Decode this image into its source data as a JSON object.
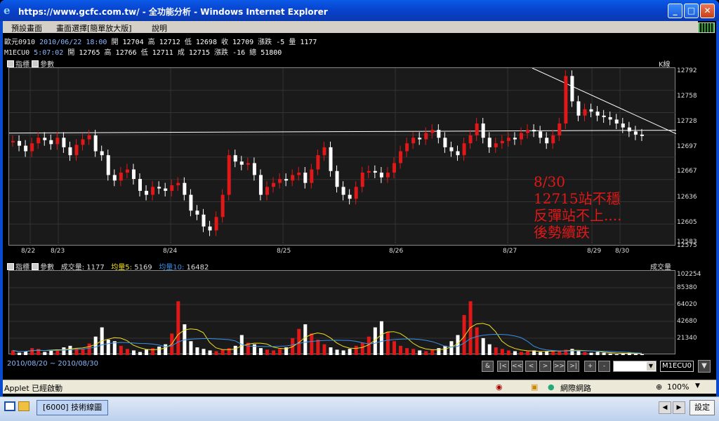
{
  "window": {
    "title": "https://www.gcfc.com.tw/ - 全功能分析 - Windows Internet Explorer"
  },
  "menu": {
    "items": [
      "預設畫面",
      "畫面選擇[簡單放大版]",
      "說明"
    ]
  },
  "quotes": [
    {
      "label": "歐元0910",
      "date": "2010/06/22 18:00",
      "open": "12704",
      "high": "12712",
      "low": "12698",
      "close_label": "收",
      "close": "12709",
      "chg": "-5",
      "vol_label": "量",
      "vol": "1177"
    },
    {
      "label": "M1ECU0",
      "date": "5:07:02",
      "open": "12765",
      "high": "12766",
      "low": "12711",
      "close_label": "成",
      "close": "12715",
      "chg": "-16",
      "vol_label": "總",
      "vol": "51800"
    }
  ],
  "quote_labels": {
    "open": "開",
    "high": "高",
    "low": "低",
    "chg": "漲跌"
  },
  "price_panel": {
    "header_indicator": "指標",
    "header_param": "參數",
    "kline_label": "K線",
    "y_ticks": [
      "12792",
      "12758",
      "12728",
      "12697",
      "12667",
      "12636",
      "12605",
      "12583",
      "12575"
    ],
    "x_ticks": [
      "8/22",
      "8/23",
      "8/24",
      "8/25",
      "8/26",
      "8/27",
      "8/29",
      "8/30"
    ]
  },
  "annotation": [
    "8/30",
    "12715站不穩",
    "反彈站不上....",
    "後勢續跌"
  ],
  "volume_panel": {
    "header_indicator": "指標",
    "header_param": "參數",
    "vol_label": "成交量:",
    "vol_value": "1177",
    "ma5_label": "均量5:",
    "ma5_value": "5169",
    "ma10_label": "均量10:",
    "ma10_value": "16482",
    "right_label": "成交量",
    "y_ticks": [
      "102254",
      "85380",
      "64020",
      "42680",
      "21340"
    ]
  },
  "range": "2010/08/20 ~ 2010/08/30",
  "nav_buttons": [
    "&",
    "|<",
    "<<",
    "<",
    ">",
    ">>",
    ">|",
    "+",
    "-"
  ],
  "symbol_box": "M1ECU0",
  "statusbar": {
    "left": "Applet 已經啟動",
    "zone": "網際網路",
    "zoom": "100%"
  },
  "taskbar": {
    "task": "[6000] 技術線圖",
    "settings": "設定"
  },
  "colors": {
    "up": "#e01818",
    "down": "#ffffff",
    "ma5": "#f0e020",
    "ma10": "#3a90e8"
  },
  "chart_data": {
    "type": "candlestick",
    "ylim": [
      12575,
      12800
    ],
    "resistance_line": [
      12800,
      12717
    ],
    "support_line": 12718,
    "candles": [
      12708,
      12702,
      12695,
      12705,
      12712,
      12709,
      12704,
      12712,
      12700,
      12690,
      12703,
      12710,
      12715,
      12695,
      12690,
      12665,
      12658,
      12668,
      12672,
      12660,
      12645,
      12640,
      12650,
      12648,
      12645,
      12652,
      12655,
      12640,
      12620,
      12615,
      12600,
      12595,
      12612,
      12640,
      12690,
      12682,
      12678,
      12680,
      12665,
      12640,
      12650,
      12655,
      12660,
      12658,
      12665,
      12668,
      12655,
      12672,
      12690,
      12700,
      12670,
      12650,
      12640,
      12635,
      12650,
      12668,
      12670,
      12668,
      12662,
      12668,
      12680,
      12695,
      12705,
      12712,
      12710,
      12718,
      12722,
      12712,
      12700,
      12695,
      12690,
      12705,
      12715,
      12730,
      12712,
      12700,
      12705,
      12708,
      12712,
      12710,
      12718,
      12722,
      12720,
      12712,
      12705,
      12715,
      12730,
      12790,
      12758,
      12740,
      12748,
      12745,
      12740,
      12738,
      12735,
      12730,
      12725,
      12720,
      12716,
      12715
    ],
    "volumes": [
      6000,
      3000,
      5000,
      9000,
      8000,
      4000,
      6000,
      7000,
      10000,
      12000,
      9000,
      8000,
      15000,
      24000,
      36000,
      20000,
      18000,
      12000,
      8000,
      6000,
      4000,
      7000,
      9000,
      11000,
      14000,
      28000,
      70000,
      40000,
      18000,
      10000,
      8000,
      6000,
      5000,
      7000,
      9000,
      12000,
      26000,
      16000,
      14000,
      9000,
      7000,
      6000,
      8000,
      10000,
      22000,
      34000,
      40000,
      28000,
      20000,
      14000,
      10000,
      7000,
      6000,
      8000,
      12000,
      16000,
      24000,
      36000,
      44000,
      30000,
      18000,
      12000,
      9000,
      8000,
      6000,
      5000,
      7000,
      9000,
      12000,
      18000,
      26000,
      52000,
      70000,
      36000,
      22000,
      14000,
      10000,
      8000,
      6000,
      5000,
      4000,
      5000,
      6000,
      4000,
      5000,
      6000,
      5000,
      7000,
      8000,
      5000,
      4000,
      3000,
      4000,
      3000,
      2000,
      1000,
      2000,
      3000,
      2000,
      1177
    ]
  }
}
